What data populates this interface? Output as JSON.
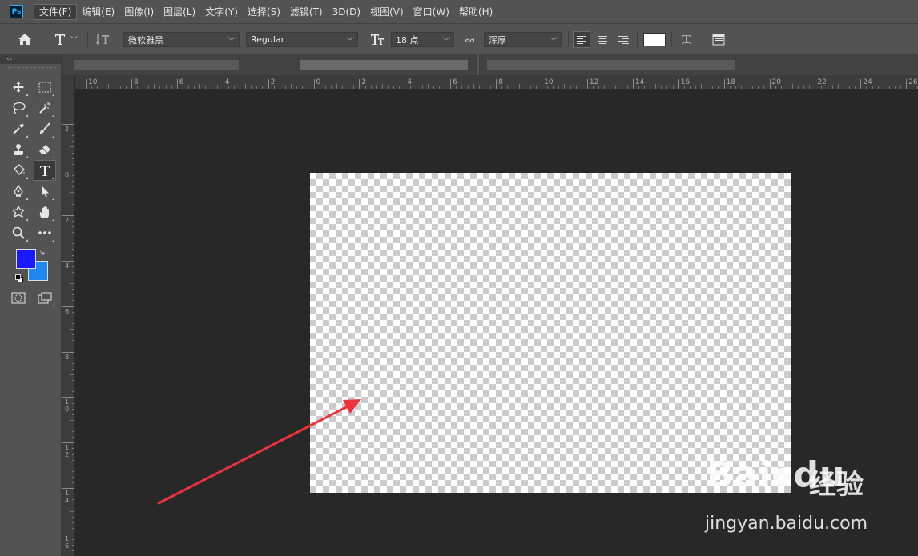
{
  "app": {
    "logo_text": "Ps"
  },
  "menu": [
    {
      "label": "文件(F)"
    },
    {
      "label": "编辑(E)"
    },
    {
      "label": "图像(I)"
    },
    {
      "label": "图层(L)"
    },
    {
      "label": "文字(Y)"
    },
    {
      "label": "选择(S)"
    },
    {
      "label": "滤镜(T)"
    },
    {
      "label": "3D(D)"
    },
    {
      "label": "视图(V)"
    },
    {
      "label": "窗口(W)"
    },
    {
      "label": "帮助(H)"
    }
  ],
  "options": {
    "font_family": "微软雅黑",
    "font_style": "Regular",
    "font_size": "18 点",
    "antialias_icon_text": "aa",
    "antialias": "浑厚",
    "color_swatch": "#ffffff"
  },
  "toolbar": {
    "collapse_glyph": "‹‹",
    "foreground_color": "#1a1aff",
    "background_color": "#1e88f0"
  },
  "rulers": {
    "horizontal": [
      "10",
      "8",
      "6",
      "4",
      "2",
      "0",
      "2",
      "4",
      "6",
      "8",
      "10",
      "12",
      "14",
      "16",
      "18",
      "20",
      "22",
      "24",
      "26"
    ],
    "vertical": [
      "2",
      "0",
      "2",
      "4",
      "6",
      "8",
      "10",
      "12",
      "14",
      "16"
    ]
  },
  "canvas": {
    "background": "transparent-checkerboard"
  },
  "annotation": {
    "type": "arrow",
    "color": "#e8343c"
  },
  "watermark": {
    "logo": "Bai",
    "logo_suffix": "du",
    "cn": "经验",
    "url": "jingyan.baidu.com"
  }
}
